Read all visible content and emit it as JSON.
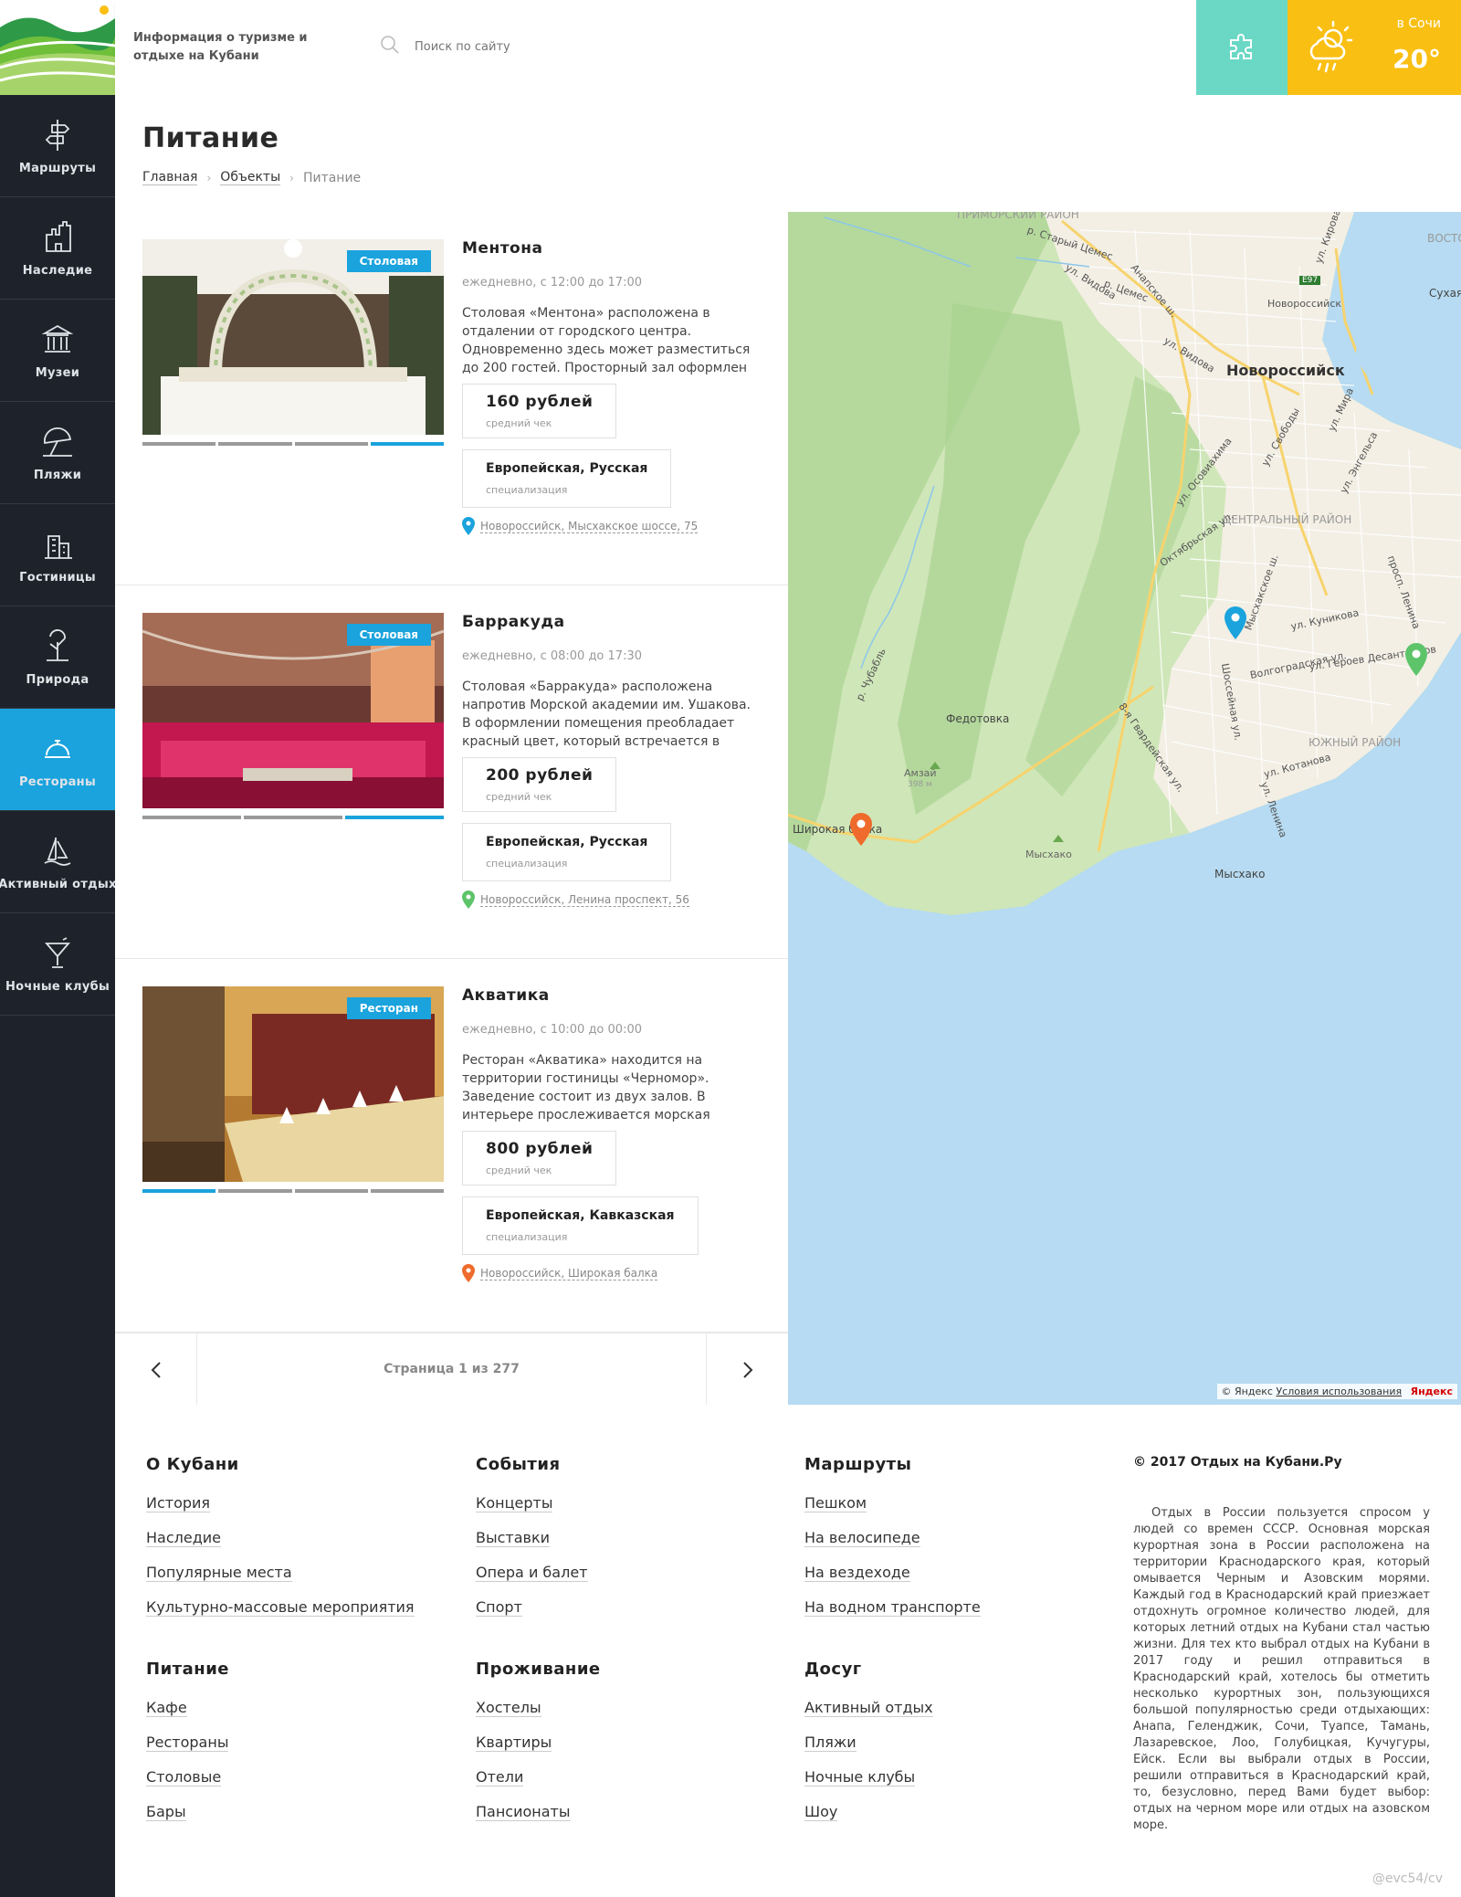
{
  "site": {
    "description": "Информация о туризме и отдыхе на Кубани",
    "search_placeholder": "Поиск по сайту",
    "weather": {
      "city": "в Сочи",
      "temp": "20°"
    }
  },
  "nav": [
    {
      "label": "Маршруты",
      "icon": "signpost-icon"
    },
    {
      "label": "Наследие",
      "icon": "castle-icon"
    },
    {
      "label": "Музеи",
      "icon": "museum-icon"
    },
    {
      "label": "Пляжи",
      "icon": "beach-umbrella-icon"
    },
    {
      "label": "Гостиницы",
      "icon": "hotel-icon"
    },
    {
      "label": "Природа",
      "icon": "nature-icon"
    },
    {
      "label": "Рестораны",
      "icon": "cloche-icon",
      "active": true
    },
    {
      "label": "Активный отдых",
      "icon": "sailboat-icon"
    },
    {
      "label": "Ночные клубы",
      "icon": "cocktail-icon"
    }
  ],
  "page": {
    "title": "Питание",
    "breadcrumb": [
      "Главная",
      "Объекты",
      "Питание"
    ]
  },
  "places": [
    {
      "name": "Ментона",
      "badge": "Столовая",
      "hours": "ежедневно, с 12:00 до 17:00",
      "description": "Столовая «Ментона» расположена в отдалении от городского центра. Одновременно здесь может разместиться до 200 гостей. Просторный зал оформлен",
      "price": "160 рублей",
      "price_label": "средний чек",
      "cuisine": "Европейская, Русская",
      "cuisine_label": "специализация",
      "address": "Новороссийск, Мысхакское шоссе, 75",
      "pin_color": "#1aa3dd",
      "slides": 4,
      "active_slide": 4
    },
    {
      "name": "Барракуда",
      "badge": "Столовая",
      "hours": "ежедневно, с 08:00 до 17:30",
      "description": "Столовая «Барракуда» расположена напротив Морской академии им. Ушакова. В оформлении помещения преобладает красный цвет, который встречается в",
      "price": "200 рублей",
      "price_label": "средний чек",
      "cuisine": "Европейская, Русская",
      "cuisine_label": "специализация",
      "address": "Новороссийск, Ленина проспект, 56",
      "pin_color": "#5ec46a",
      "slides": 3,
      "active_slide": 3
    },
    {
      "name": "Акватика",
      "badge": "Ресторан",
      "hours": "ежедневно, с 10:00 до 00:00",
      "description": "Ресторан «Акватика» находится на территории гостиницы «Черномор». Заведение состоит из двух залов. В интерьере прослеживается морская",
      "price": "800 рублей",
      "price_label": "средний чек",
      "cuisine": "Европейская, Кавказская",
      "cuisine_label": "специализация",
      "address": "Новороссийск, Широкая балка",
      "pin_color": "#ef6b2b",
      "slides": 4,
      "active_slide": 1
    }
  ],
  "pager": {
    "text": "Страница 1 из 277"
  },
  "map": {
    "labels": {
      "city": "Новороссийск",
      "district_primorsky": "ПРИМОРСКИЙ РАЙОН",
      "district_central": "ЦЕНТРАЛЬНЫЙ РАЙОН",
      "district_south": "ЮЖНЫЙ РАЙОН",
      "fedotovka": "Федотовка",
      "amzay": "Амзай",
      "amzay_height": "398 м",
      "myskhako_peak": "Мысхако",
      "myskhako": "Мысхако",
      "shirokaya_balka": "Широкая балка",
      "vostochny": "ВОСТОЧНЫЙ",
      "sukhaya": "Сухая",
      "tsemes_old": "р. Старый Цемес",
      "tsemes": "р. Цемес",
      "novorossiysk_station": "Новороссийск",
      "kirov": "ул. Кирова",
      "vidova1": "ул. Видова",
      "anapskoe": "Анапское ш.",
      "vidova2": "ул. Видова",
      "svobody": "ул. Свободы",
      "mira": "ул. Мира",
      "engelsa": "ул. Энгельса",
      "osovina": "ул. Осовиахима",
      "oktyabrskaya": "Октябрьская ул.",
      "myskhakskoe": "Мысхакское ш.",
      "kunikova": "ул. Куникова",
      "lenina_pr": "просп. Ленина",
      "geroev": "ул. Героев Десантников",
      "volgogradskaya": "Волгоградская ул.",
      "shosseynaya": "Шоссейная ул.",
      "gvardeyskaya": "8-я Гвардейская ул.",
      "kotanova": "ул. Котанова",
      "lenina": "ул. Ленина",
      "chubabl": "р. Чубабль",
      "e97": "E97"
    },
    "copyright": "© Яндекс",
    "terms": "Условия использования",
    "brand": "Яндекс"
  },
  "footer": {
    "columns": [
      [
        {
          "title": "О Кубани",
          "links": [
            "История",
            "Наследие",
            "Популярные места",
            "Культурно-массовые мероприятия"
          ]
        },
        {
          "title": "Питание",
          "links": [
            "Кафе",
            "Рестораны",
            "Столовые",
            "Бары"
          ]
        }
      ],
      [
        {
          "title": "События",
          "links": [
            "Концерты",
            "Выставки",
            "Опера и балет",
            "Спорт"
          ]
        },
        {
          "title": "Проживание",
          "links": [
            "Хостелы",
            "Квартиры",
            "Отели",
            "Пансионаты"
          ]
        }
      ],
      [
        {
          "title": "Маршруты",
          "links": [
            "Пешком",
            "На велосипеде",
            "На вездеходе",
            "На водном транспорте"
          ]
        },
        {
          "title": "Досуг",
          "links": [
            "Активный отдых",
            "Пляжи",
            "Ночные клубы",
            "Шоу"
          ]
        }
      ]
    ],
    "copyright": "© 2017 Отдых на Кубани.Ру",
    "text": "Отдых в России пользуется спросом у людей со времен СССР. Основная морская курортная зона в России расположена на территории Краснодарского края, который омывается Черным и Азовским морями. Каждый год в Краснодарский край приезжает отдохнуть огромное количество людей, для которых летний отдых на Кубани стал частью жизни. Для тех кто выбрал отдых на Кубани в 2017 году и решил отправиться в Краснодарский край, хотелось бы отметить несколько курортных зон, пользующихся большой популярностью среди отдыхающих: Анапа, Геленджик, Сочи, Туапсе, Тамань, Лазаревское, Лоо, Голубицкая, Кучугуры, Ейск. Если вы выбрали отдых в России, решили отправиться в Краснодарский край, то, безусловно, перед Вами будет выбор: отдых на черном море или отдых на азовском море.",
    "credit": "@evc54/cv"
  }
}
